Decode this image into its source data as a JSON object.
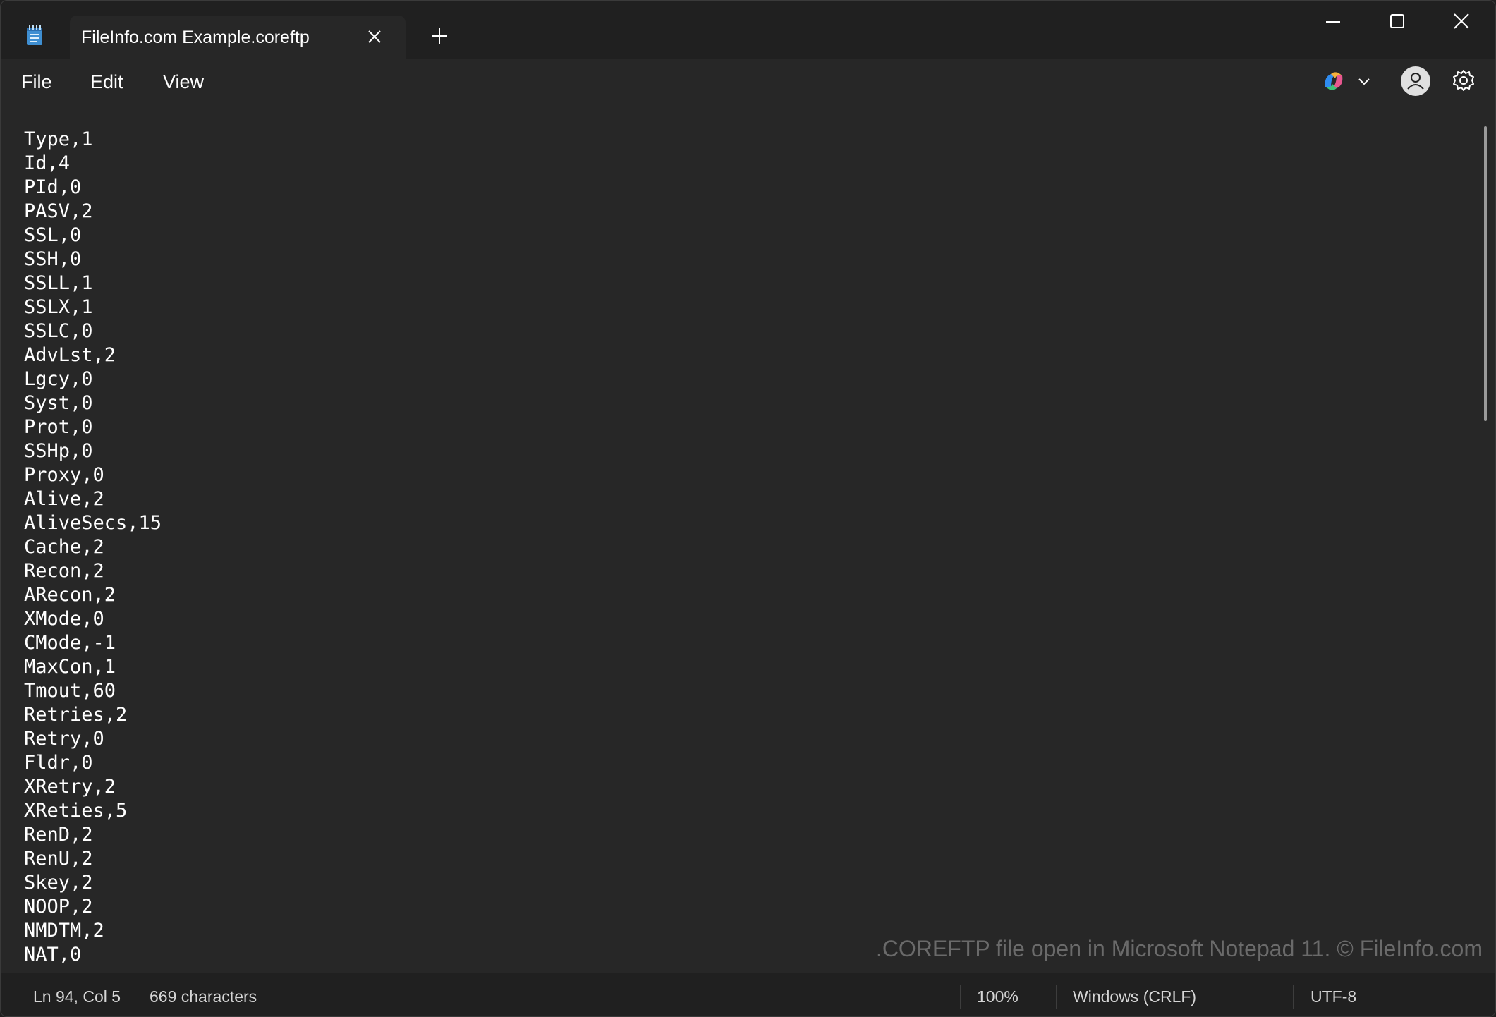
{
  "tab": {
    "title": "FileInfo.com Example.coreftp"
  },
  "menu": {
    "file": "File",
    "edit": "Edit",
    "view": "View"
  },
  "editor": {
    "lines": [
      "Type,1",
      "Id,4",
      "PId,0",
      "PASV,2",
      "SSL,0",
      "SSH,0",
      "SSLL,1",
      "SSLX,1",
      "SSLC,0",
      "AdvLst,2",
      "Lgcy,0",
      "Syst,0",
      "Prot,0",
      "SSHp,0",
      "Proxy,0",
      "Alive,2",
      "AliveSecs,15",
      "Cache,2",
      "Recon,2",
      "ARecon,2",
      "XMode,0",
      "CMode,-1",
      "MaxCon,1",
      "Tmout,60",
      "Retries,2",
      "Retry,0",
      "Fldr,0",
      "XRetry,2",
      "XReties,5",
      "RenD,2",
      "RenU,2",
      "Skey,2",
      "NOOP,2",
      "NMDTM,2",
      "NAT,0"
    ],
    "watermark": ".COREFTP file open in Microsoft Notepad 11. © FileInfo.com"
  },
  "status": {
    "position": "Ln 94, Col 5",
    "characters": "669 characters",
    "zoom": "100%",
    "line_endings": "Windows (CRLF)",
    "encoding": "UTF-8"
  },
  "icons": {
    "app": "notepad-icon",
    "tab_close": "close-icon",
    "new_tab": "plus-icon",
    "minimize": "minimize-icon",
    "maximize": "maximize-icon",
    "close": "close-icon",
    "copilot": "copilot-icon",
    "dropdown": "chevron-down-icon",
    "account": "avatar-icon",
    "settings": "gear-icon"
  },
  "colors": {
    "background": "#272727",
    "titlebar": "#202020",
    "text": "#ffffff",
    "notepad_accent": "#4aa3df"
  }
}
